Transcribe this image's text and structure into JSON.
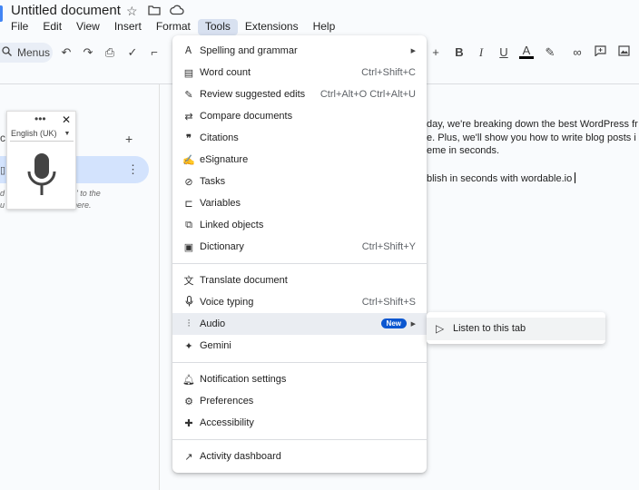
{
  "header": {
    "doc_title": "Untitled document",
    "menu": [
      {
        "label": "File"
      },
      {
        "label": "Edit"
      },
      {
        "label": "View"
      },
      {
        "label": "Insert"
      },
      {
        "label": "Format"
      },
      {
        "label": "Tools"
      },
      {
        "label": "Extensions"
      },
      {
        "label": "Help"
      }
    ]
  },
  "toolbar": {
    "menus_label": "Menus"
  },
  "voice_widget": {
    "language": "English (UK)"
  },
  "document": {
    "lines": [
      "day, we're breaking down the best WordPress fr",
      "e. Plus, we'll show you how to write blog posts i",
      "eme in seconds.",
      "blish in seconds with wordable.io"
    ]
  },
  "sidebar": {
    "hint_lines": [
      "' to the",
      "here."
    ]
  },
  "tools_menu": {
    "items": [
      {
        "label": "Spelling and grammar",
        "icon": "spellcheck-icon",
        "shortcut": "",
        "submenu": true
      },
      {
        "label": "Word count",
        "icon": "word-count-icon",
        "shortcut": "Ctrl+Shift+C"
      },
      {
        "label": "Review suggested edits",
        "icon": "review-edits-icon",
        "shortcut": "Ctrl+Alt+O Ctrl+Alt+U"
      },
      {
        "label": "Compare documents",
        "icon": "compare-icon",
        "shortcut": ""
      },
      {
        "label": "Citations",
        "icon": "quote-icon",
        "shortcut": ""
      },
      {
        "label": "eSignature",
        "icon": "signature-icon",
        "shortcut": ""
      },
      {
        "label": "Tasks",
        "icon": "tasks-icon",
        "shortcut": ""
      },
      {
        "label": "Variables",
        "icon": "variables-icon",
        "shortcut": ""
      },
      {
        "label": "Linked objects",
        "icon": "linked-objects-icon",
        "shortcut": ""
      },
      {
        "label": "Dictionary",
        "icon": "dictionary-icon",
        "shortcut": "Ctrl+Shift+Y"
      },
      {
        "label": "Translate document",
        "icon": "translate-icon",
        "shortcut": ""
      },
      {
        "label": "Voice typing",
        "icon": "microphone-icon",
        "shortcut": "Ctrl+Shift+S"
      },
      {
        "label": "Audio",
        "icon": "audio-icon",
        "badge": "New",
        "submenu": true
      },
      {
        "label": "Gemini",
        "icon": "gemini-icon",
        "shortcut": ""
      },
      {
        "label": "Notification settings",
        "icon": "bell-icon",
        "shortcut": ""
      },
      {
        "label": "Preferences",
        "icon": "preferences-icon",
        "shortcut": ""
      },
      {
        "label": "Accessibility",
        "icon": "accessibility-icon",
        "shortcut": ""
      },
      {
        "label": "Activity dashboard",
        "icon": "trending-icon",
        "shortcut": ""
      }
    ]
  },
  "audio_submenu": {
    "items": [
      {
        "label": "Listen to this tab",
        "icon": "listen-icon"
      }
    ]
  },
  "colors": {
    "accent": "#0b57d0",
    "menu_active": "#d8e1f0",
    "outline_pill": "#d3e3fd"
  }
}
